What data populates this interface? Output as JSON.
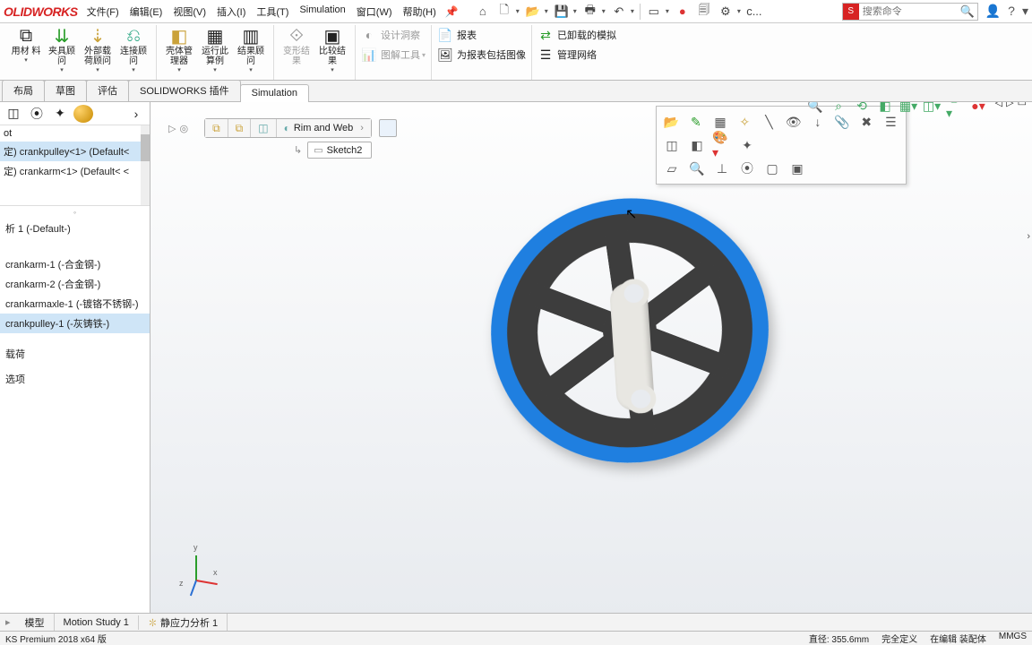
{
  "logo": "OLIDWORKS",
  "menu": [
    "文件(F)",
    "编辑(E)",
    "视图(V)",
    "插入(I)",
    "工具(T)",
    "Simulation",
    "窗口(W)",
    "帮助(H)"
  ],
  "search_placeholder": "搜索命令",
  "search_prefix": "c...",
  "ribbon": {
    "g1": [
      {
        "l": "用材\n料"
      },
      {
        "l": "夹具顾\n问"
      },
      {
        "l": "外部载\n荷顾问"
      },
      {
        "l": "连接顾\n问"
      }
    ],
    "g2": [
      {
        "l": "壳体管\n理器"
      },
      {
        "l": "运行此\n算例"
      },
      {
        "l": "结果顾\n问"
      }
    ],
    "g3": [
      {
        "l": "变形结\n果",
        "d": true
      },
      {
        "l": "比较结\n果"
      }
    ],
    "g4": [
      {
        "l": "设计洞察",
        "d": true
      },
      {
        "l": "图解工具",
        "d": true
      }
    ],
    "g5": [
      {
        "l": "报表"
      },
      {
        "l": "为报表包括图像"
      }
    ],
    "g6": [
      {
        "l": "已卸载的模拟"
      },
      {
        "l": "管理网络"
      }
    ]
  },
  "cmdtabs": [
    "布局",
    "草图",
    "评估",
    "SOLIDWORKS 插件",
    "Simulation"
  ],
  "active_cmdtab": 4,
  "lp_tree": {
    "root": "ot",
    "items": [
      "定) crankpulley<1> (Default<",
      "定) crankarm<1> (Default< <"
    ]
  },
  "lp_mid": {
    "study": "析 1 (-Default-)",
    "parts": [
      "crankarm-1 (-合金钢-)",
      "crankarm-2 (-合金钢-)",
      "crankarmaxle-1 (-镀铬不锈钢-)",
      "crankpulley-1 (-灰铸铁-)"
    ],
    "tail": [
      "",
      "",
      "载荷",
      "",
      "选项"
    ],
    "selected": 3
  },
  "breadcrumb": {
    "feat": "Rim and Web"
  },
  "sketch": "Sketch2",
  "btabs": [
    "模型",
    "Motion Study 1",
    "静应力分析 1"
  ],
  "status": {
    "left": "KS Premium 2018 x64 版",
    "diam": "直径: 355.6mm",
    "def": "完全定义",
    "mode": "在编辑 装配体",
    "units": "MMGS"
  }
}
